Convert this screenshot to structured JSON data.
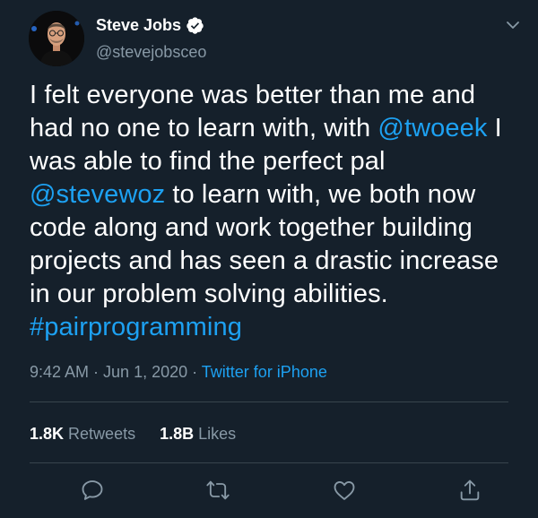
{
  "tweet": {
    "author": {
      "display_name": "Steve Jobs",
      "handle": "@stevejobsceo",
      "verified": true
    },
    "text_lines": [
      [
        {
          "t": "I felt everyone was better than me and",
          "link": false
        }
      ],
      [
        {
          "t": "had no one to learn with, with ",
          "link": false
        },
        {
          "t": "@twoeek",
          "link": true
        },
        {
          "t": " I",
          "link": false
        }
      ],
      [
        {
          "t": "was able to find the perfect pal",
          "link": false
        }
      ],
      [
        {
          "t": "@stevewoz",
          "link": true
        },
        {
          "t": " to learn with, we both now",
          "link": false
        }
      ],
      [
        {
          "t": "code along and work together building",
          "link": false
        }
      ],
      [
        {
          "t": "projects and has seen a drastic increase",
          "link": false
        }
      ],
      [
        {
          "t": "in our problem solving abilities.",
          "link": false
        }
      ],
      [
        {
          "t": "#pairprogramming",
          "link": true
        }
      ]
    ],
    "time": "9:42 AM",
    "separator": " · ",
    "date": "Jun 1, 2020",
    "source": "Twitter for iPhone",
    "retweets_count": "1.8K",
    "retweets_label": "Retweets",
    "likes_count": "1.8B",
    "likes_label": "Likes"
  },
  "icons": {
    "verified": "verified-badge-icon",
    "caret": "chevron-down-icon",
    "reply": "reply-icon",
    "retweet": "retweet-icon",
    "like": "heart-icon",
    "share": "share-icon"
  },
  "colors": {
    "background": "#15202b",
    "text": "#ffffff",
    "secondary": "#8899a6",
    "accent": "#1da1f2",
    "divider": "#38444d"
  }
}
